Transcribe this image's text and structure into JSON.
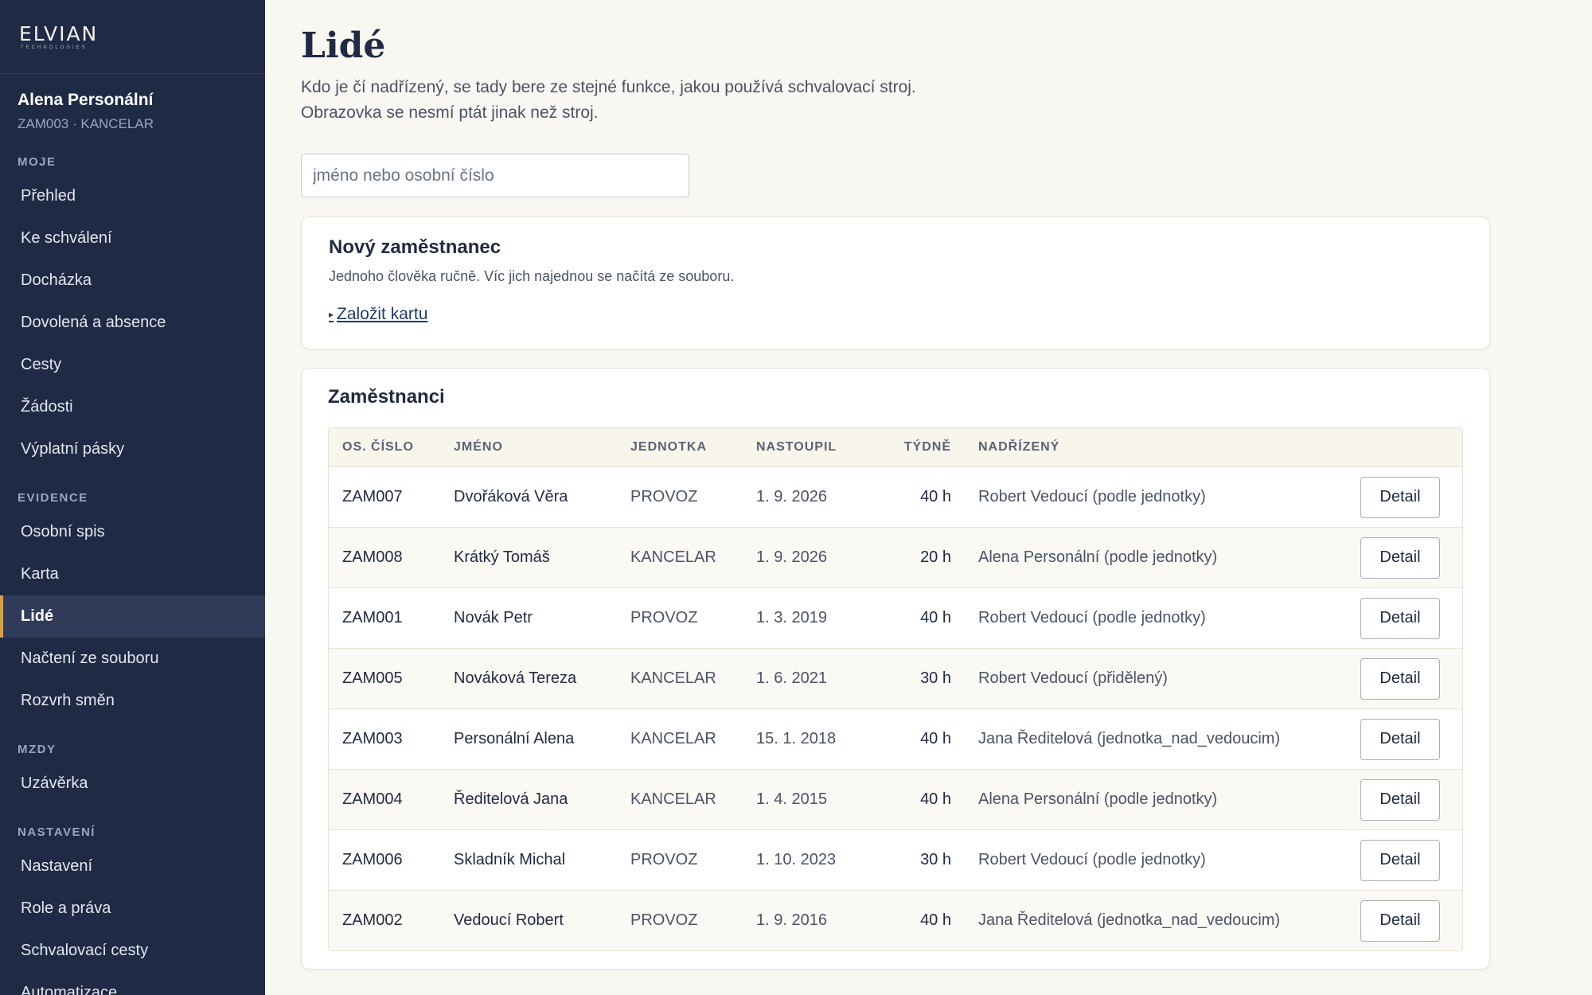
{
  "brand": {
    "logo": "ELVIAN",
    "logo_sub": "TECHNOLOGIES"
  },
  "user": {
    "name": "Alena Personální",
    "sub": "ZAM003 · KANCELAR"
  },
  "sidebar": {
    "sections": [
      {
        "label": "MOJE",
        "items": [
          "Přehled",
          "Ke schválení",
          "Docházka",
          "Dovolená a absence",
          "Cesty",
          "Žádosti",
          "Výplatní pásky"
        ]
      },
      {
        "label": "EVIDENCE",
        "items": [
          "Osobní spis",
          "Karta",
          "Lidé",
          "Načtení ze souboru",
          "Rozvrh směn"
        ]
      },
      {
        "label": "MZDY",
        "items": [
          "Uzávěrka"
        ]
      },
      {
        "label": "NASTAVENÍ",
        "items": [
          "Nastavení",
          "Role a práva",
          "Schvalovací cesty",
          "Automatizace"
        ]
      }
    ],
    "active": "Lidé"
  },
  "page": {
    "title": "Lidé",
    "desc_line1": "Kdo je čí nadřízený, se tady bere ze stejné funkce, jakou používá schvalovací stroj.",
    "desc_line2": "Obrazovka se nesmí ptát jinak než stroj."
  },
  "search": {
    "placeholder": "jméno nebo osobní číslo",
    "value": ""
  },
  "new_employee": {
    "title": "Nový zaměstnanec",
    "subtitle": "Jednoho člověka ručně. Víc jich najednou se načítá ze souboru.",
    "link": "Založit kartu"
  },
  "employees": {
    "title": "Zaměstnanci",
    "columns": [
      "OS. ČÍSLO",
      "JMÉNO",
      "JEDNOTKA",
      "NASTOUPIL",
      "TÝDNĚ",
      "NADŘÍZENÝ"
    ],
    "action_label": "Detail",
    "rows": [
      {
        "id": "ZAM007",
        "name": "Dvořáková Věra",
        "unit": "PROVOZ",
        "start": "1. 9. 2026",
        "hours": "40 h",
        "supervisor": "Robert Vedoucí (podle jednotky)"
      },
      {
        "id": "ZAM008",
        "name": "Krátký Tomáš",
        "unit": "KANCELAR",
        "start": "1. 9. 2026",
        "hours": "20 h",
        "supervisor": "Alena Personální (podle jednotky)"
      },
      {
        "id": "ZAM001",
        "name": "Novák Petr",
        "unit": "PROVOZ",
        "start": "1. 3. 2019",
        "hours": "40 h",
        "supervisor": "Robert Vedoucí (podle jednotky)"
      },
      {
        "id": "ZAM005",
        "name": "Nováková Tereza",
        "unit": "KANCELAR",
        "start": "1. 6. 2021",
        "hours": "30 h",
        "supervisor": "Robert Vedoucí (přidělený)"
      },
      {
        "id": "ZAM003",
        "name": "Personální Alena",
        "unit": "KANCELAR",
        "start": "15. 1. 2018",
        "hours": "40 h",
        "supervisor": "Jana Ředitelová (jednotka_nad_vedoucim)"
      },
      {
        "id": "ZAM004",
        "name": "Ředitelová Jana",
        "unit": "KANCELAR",
        "start": "1. 4. 2015",
        "hours": "40 h",
        "supervisor": "Alena Personální (podle jednotky)"
      },
      {
        "id": "ZAM006",
        "name": "Skladník Michal",
        "unit": "PROVOZ",
        "start": "1. 10. 2023",
        "hours": "30 h",
        "supervisor": "Robert Vedoucí (podle jednotky)"
      },
      {
        "id": "ZAM002",
        "name": "Vedoucí Robert",
        "unit": "PROVOZ",
        "start": "1. 9. 2016",
        "hours": "40 h",
        "supervisor": "Jana Ředitelová (jednotka_nad_vedoucim)"
      }
    ]
  },
  "colors": {
    "sidebar_bg": "#1f2a44",
    "accent": "#d3a24a",
    "page_bg": "#f9f7f1"
  }
}
